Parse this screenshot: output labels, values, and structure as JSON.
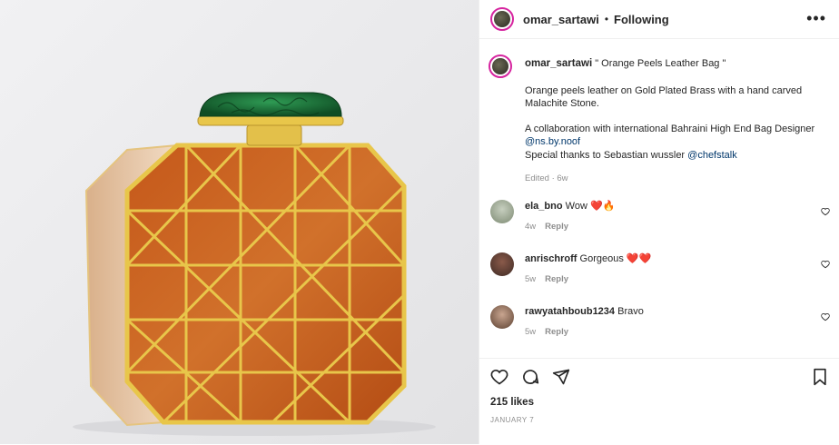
{
  "post": {
    "username": "omar_sartawi",
    "separator": "•",
    "follow_status": "Following",
    "more": "•••"
  },
  "caption": {
    "username": "omar_sartawi",
    "title": " \" Orange Peels Leather Bag \"",
    "line1": "Orange peels leather on Gold Plated Brass with a hand carved Malachite Stone.",
    "line2": "A collaboration with international Bahraini High End Bag Designer",
    "mention1": "@ns.by.noof",
    "line3": "Special thanks to Sebastian wussler ",
    "mention2": "@chefstalk",
    "edited": "Edited · 6w"
  },
  "comments": [
    {
      "user": "ela_bno",
      "text": "Wow",
      "emoji": "❤️🔥",
      "time": "4w",
      "reply": "Reply"
    },
    {
      "user": "anrischroff",
      "text": "Gorgeous",
      "emoji": "❤️❤️",
      "time": "5w",
      "reply": "Reply"
    },
    {
      "user": "rawyatahboub1234",
      "text": "Bravo",
      "emoji": "",
      "time": "5w",
      "reply": "Reply"
    }
  ],
  "likes": "215 likes",
  "date": "JANUARY 7",
  "colors": {
    "accent_link": "#00376b",
    "story_ring": "#d6249f",
    "leather": "#c8601a",
    "gold": "#e8c64a",
    "malachite": "#1d7a3c"
  },
  "icons": [
    "heart-icon",
    "comment-icon",
    "share-icon",
    "bookmark-icon",
    "more-icon"
  ]
}
